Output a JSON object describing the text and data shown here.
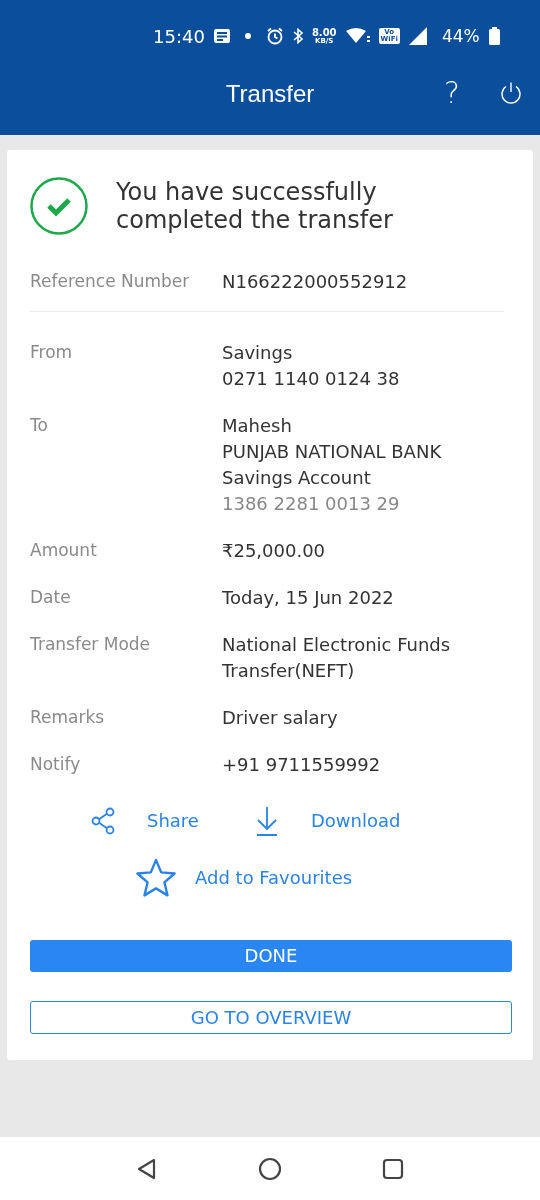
{
  "status_bar": {
    "time": "15:40",
    "speed_value": "8.00",
    "speed_unit": "KB/S",
    "vowifi_top": "Vo",
    "vowifi_bottom": "WiFi",
    "battery": "44%"
  },
  "header": {
    "title": "Transfer",
    "help": "?"
  },
  "success": {
    "message": "You have successfully completed the transfer"
  },
  "reference": {
    "label": "Reference Number",
    "value": "N166222000552912"
  },
  "details": [
    {
      "label": "From",
      "lines": [
        {
          "text": "Savings",
          "muted": false
        },
        {
          "text": "0271 1140 0124 38",
          "muted": false
        }
      ]
    },
    {
      "label": "To",
      "lines": [
        {
          "text": "Mahesh",
          "muted": false
        },
        {
          "text": "PUNJAB NATIONAL BANK",
          "muted": false
        },
        {
          "text": "Savings Account",
          "muted": false
        },
        {
          "text": "1386 2281 0013 29",
          "muted": true
        }
      ]
    },
    {
      "label": "Amount",
      "lines": [
        {
          "text": "₹25,000.00",
          "muted": false
        }
      ]
    },
    {
      "label": "Date",
      "lines": [
        {
          "text": "Today, 15 Jun 2022",
          "muted": false
        }
      ]
    },
    {
      "label": "Transfer Mode",
      "lines": [
        {
          "text": "National Electronic Funds",
          "muted": false
        },
        {
          "text": "Transfer(NEFT)",
          "muted": false
        }
      ]
    },
    {
      "label": "Remarks",
      "lines": [
        {
          "text": "Driver salary",
          "muted": false
        }
      ]
    },
    {
      "label": "Notify",
      "lines": [
        {
          "text": "+91 9711559992",
          "muted": false
        }
      ]
    }
  ],
  "actions": {
    "share": "Share",
    "download": "Download",
    "favourite": "Add to Favourites"
  },
  "buttons": {
    "primary": "DONE",
    "secondary": "GO TO OVERVIEW"
  }
}
